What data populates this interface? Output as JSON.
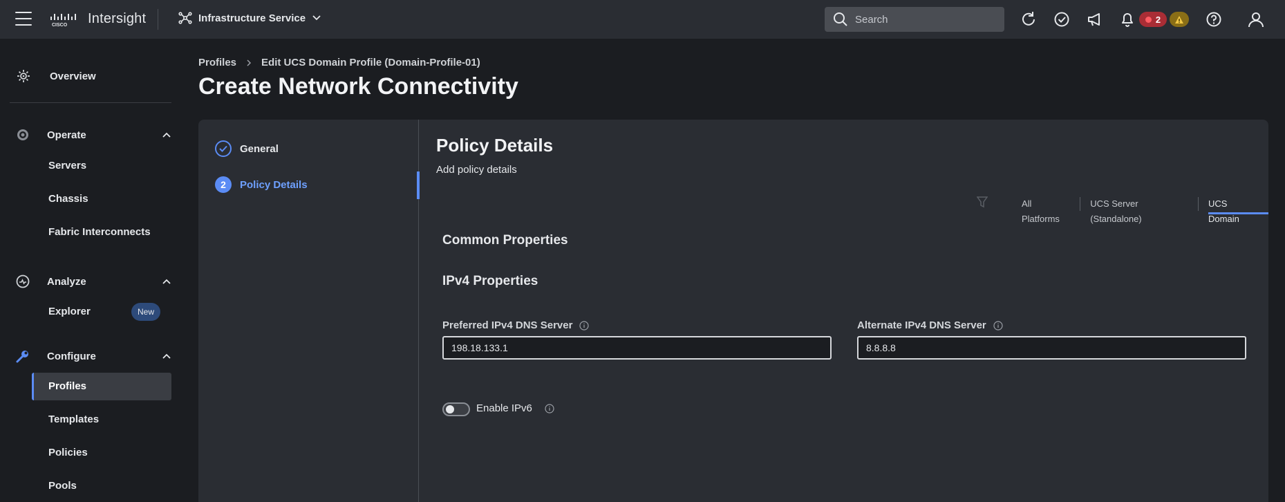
{
  "topbar": {
    "app_name": "Intersight",
    "service_label": "Infrastructure Service",
    "search_placeholder": "Search",
    "alarm_critical_count": "2"
  },
  "sidebar": {
    "overview_label": "Overview",
    "sections": [
      {
        "label": "Operate",
        "items": [
          "Servers",
          "Chassis",
          "Fabric Interconnects"
        ]
      },
      {
        "label": "Analyze",
        "items": [
          "Explorer"
        ]
      },
      {
        "label": "Configure",
        "items": [
          "Profiles",
          "Templates",
          "Policies",
          "Pools"
        ]
      }
    ],
    "explorer_badge": "New",
    "active_item": "Profiles"
  },
  "breadcrumb": {
    "items": [
      "Profiles",
      "Edit UCS Domain Profile (Domain-Profile-01)"
    ]
  },
  "page_title": "Create Network Connectivity",
  "wizard": {
    "steps": [
      {
        "number": "1",
        "label": "General",
        "state": "completed"
      },
      {
        "number": "2",
        "label": "Policy Details",
        "state": "active"
      }
    ]
  },
  "policy": {
    "title": "Policy Details",
    "subtitle": "Add policy details",
    "platform_tabs": [
      "All Platforms",
      "UCS Server (Standalone)",
      "UCS Domain"
    ],
    "active_tab": "UCS Domain",
    "common_heading": "Common Properties",
    "ipv4_heading": "IPv4 Properties",
    "preferred_label": "Preferred IPv4 DNS Server",
    "preferred_value": "198.18.133.1",
    "alternate_label": "Alternate IPv4 DNS Server",
    "alternate_value": "8.8.8.8",
    "ipv6_label": "Enable IPv6",
    "ipv6_enabled": false
  },
  "colors": {
    "accent": "#5b8cf5",
    "background": "#1b1d21",
    "panel": "#2a2d33",
    "critical": "#a92d35",
    "warning": "#8a6e16"
  }
}
